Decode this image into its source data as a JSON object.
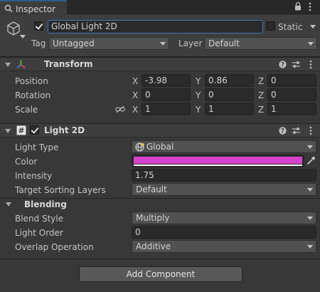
{
  "window": {
    "tab_label": "Inspector"
  },
  "gameobject": {
    "active": true,
    "name": "Global Light 2D",
    "static_label": "Static",
    "static_checked": false,
    "tag_label": "Tag",
    "tag_value": "Untagged",
    "layer_label": "Layer",
    "layer_value": "Default"
  },
  "transform": {
    "title": "Transform",
    "position": {
      "label": "Position",
      "x": "-3.98",
      "y": "0.86",
      "z": "0"
    },
    "rotation": {
      "label": "Rotation",
      "x": "0",
      "y": "0",
      "z": "0"
    },
    "scale": {
      "label": "Scale",
      "x": "1",
      "y": "1",
      "z": "1"
    },
    "axis_x": "X",
    "axis_y": "Y",
    "axis_z": "Z"
  },
  "light2d": {
    "title": "Light 2D",
    "enabled": true,
    "light_type": {
      "label": "Light Type",
      "value": "Global"
    },
    "color": {
      "label": "Color",
      "value": "#d642cf"
    },
    "intensity": {
      "label": "Intensity",
      "value": "1.75"
    },
    "sorting_layers": {
      "label": "Target Sorting Layers",
      "value": "Default"
    },
    "blending_section": "Blending",
    "blend_style": {
      "label": "Blend Style",
      "value": "Multiply"
    },
    "light_order": {
      "label": "Light Order",
      "value": "0"
    },
    "overlap_operation": {
      "label": "Overlap Operation",
      "value": "Additive"
    }
  },
  "add_component_label": "Add Component",
  "colors": {
    "background": "#383838",
    "header": "#3e3e3e",
    "field": "#2a2a2a",
    "accent": "#3a79bb"
  }
}
